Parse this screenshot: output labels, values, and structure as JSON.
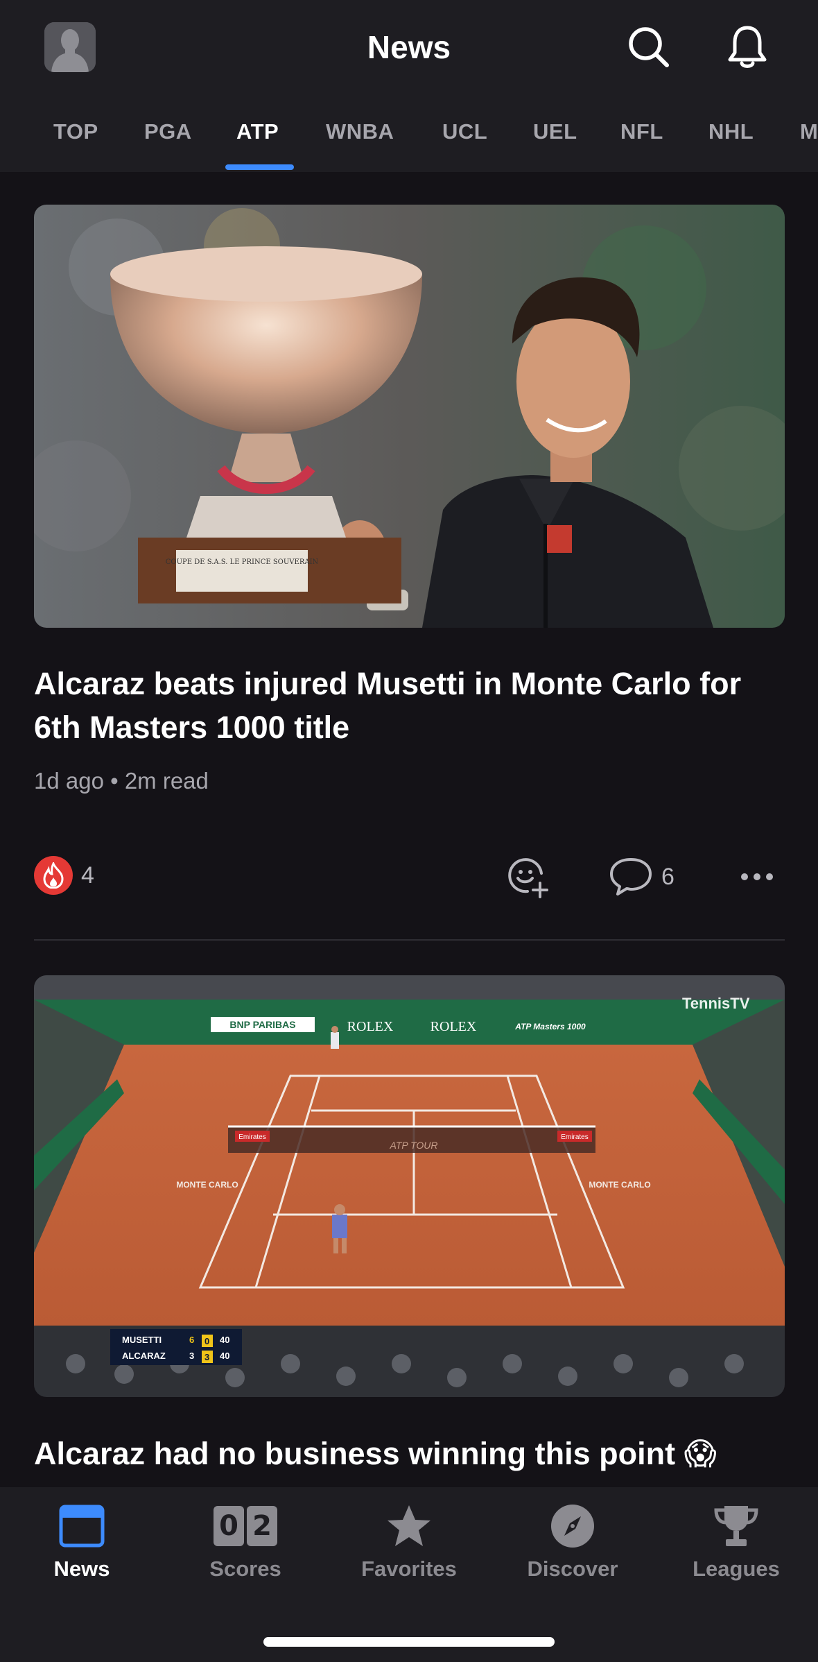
{
  "header": {
    "title": "News"
  },
  "tabs": [
    "TOP",
    "PGA",
    "ATP",
    "WNBA",
    "UCL",
    "UEL",
    "NFL",
    "NHL",
    "M"
  ],
  "active_tab": "ATP",
  "colors": {
    "accent": "#3d8bfd",
    "background": "#141217",
    "bar": "#1e1d22",
    "reaction_badge": "#e53935"
  },
  "articles": [
    {
      "headline": "Alcaraz beats injured Musetti in Monte Carlo for 6th Masters 1000 title",
      "meta": "1d ago • 2m read",
      "reaction_count": "4",
      "comment_count": "6",
      "image": {
        "trophy_plaque": "COUPE DE S.A.S. LE PRINCE SOUVERAIN"
      }
    },
    {
      "headline": "Alcaraz had no business winning this point 😱",
      "video": {
        "watermark": "TennisTV",
        "sponsors": [
          "BNP PARIBAS",
          "ROLEX",
          "ROLEX",
          "ATP Masters 1000",
          "Emirates",
          "ATP TOUR",
          "Emirates",
          "MONTE CARLO",
          "MONTE CARLO"
        ],
        "scoreboard": [
          {
            "player": "MUSETTI",
            "set1": "6",
            "set2": "0",
            "game": "40"
          },
          {
            "player": "ALCARAZ",
            "set1": "3",
            "set2": "3",
            "game": "40"
          }
        ]
      }
    }
  ],
  "bottom_nav": [
    {
      "label": "News",
      "icon": "news-icon"
    },
    {
      "label": "Scores",
      "icon": "scores-icon",
      "digits": [
        "0",
        "2"
      ]
    },
    {
      "label": "Favorites",
      "icon": "star-icon"
    },
    {
      "label": "Discover",
      "icon": "compass-icon"
    },
    {
      "label": "Leagues",
      "icon": "trophy-icon"
    }
  ]
}
